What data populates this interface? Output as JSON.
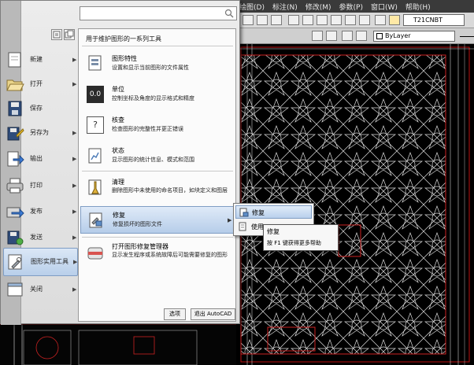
{
  "cad": {
    "menubar": [
      "绘图(D)",
      "标注(N)",
      "修改(M)",
      "参数(P)",
      "窗口(W)",
      "帮助(H)"
    ],
    "text_style": "T21CNBT",
    "layer": "ByLayer"
  },
  "app_menu": {
    "search": {
      "value": "",
      "placeholder": ""
    },
    "left_items": [
      {
        "label": "新建",
        "icon": "new-document-icon"
      },
      {
        "label": "打开",
        "icon": "open-folder-icon"
      },
      {
        "label": "保存",
        "icon": "save-disk-icon"
      },
      {
        "label": "另存为",
        "icon": "save-as-icon"
      },
      {
        "label": "输出",
        "icon": "export-icon"
      },
      {
        "label": "打印",
        "icon": "printer-icon"
      },
      {
        "label": "发布",
        "icon": "publish-icon"
      },
      {
        "label": "发送",
        "icon": "send-icon"
      },
      {
        "label": "图形实用工具",
        "icon": "drawing-utilities-icon"
      },
      {
        "label": "关闭",
        "icon": "close-document-icon"
      }
    ],
    "submenu": {
      "header": "用于维护图形的一系列工具",
      "items": [
        {
          "title": "图形特性",
          "desc": "设置和显示当前图形的文件属性",
          "icon": "drawing-properties-icon"
        },
        {
          "title": "单位",
          "desc": "控制坐标及角度的显示格式和精度",
          "icon": "units-icon",
          "icon_text": "0.0"
        },
        {
          "title": "核查",
          "desc": "检查图形的完整性并更正错误",
          "icon": "audit-icon",
          "icon_text": "?"
        },
        {
          "title": "状态",
          "desc": "显示图形的统计信息、模式和范围",
          "icon": "status-icon"
        },
        {
          "title": "清理",
          "desc": "删除图形中未使用的命名项目，如块定义和图层",
          "icon": "purge-icon"
        },
        {
          "title": "修复",
          "desc": "修复损坏的图形文件",
          "icon": "recover-icon"
        },
        {
          "title": "打开图形修复管理器",
          "desc": "显示发生程序或系统故障后可能需要修复的图形",
          "icon": "recovery-manager-icon"
        }
      ]
    },
    "buttons": {
      "options": "选项",
      "exit": "退出 AutoCAD"
    }
  },
  "flyout": {
    "items": [
      "修复",
      "使用"
    ]
  },
  "tooltip": {
    "title": "修复",
    "text": "按 F1 键获得更多帮助"
  }
}
